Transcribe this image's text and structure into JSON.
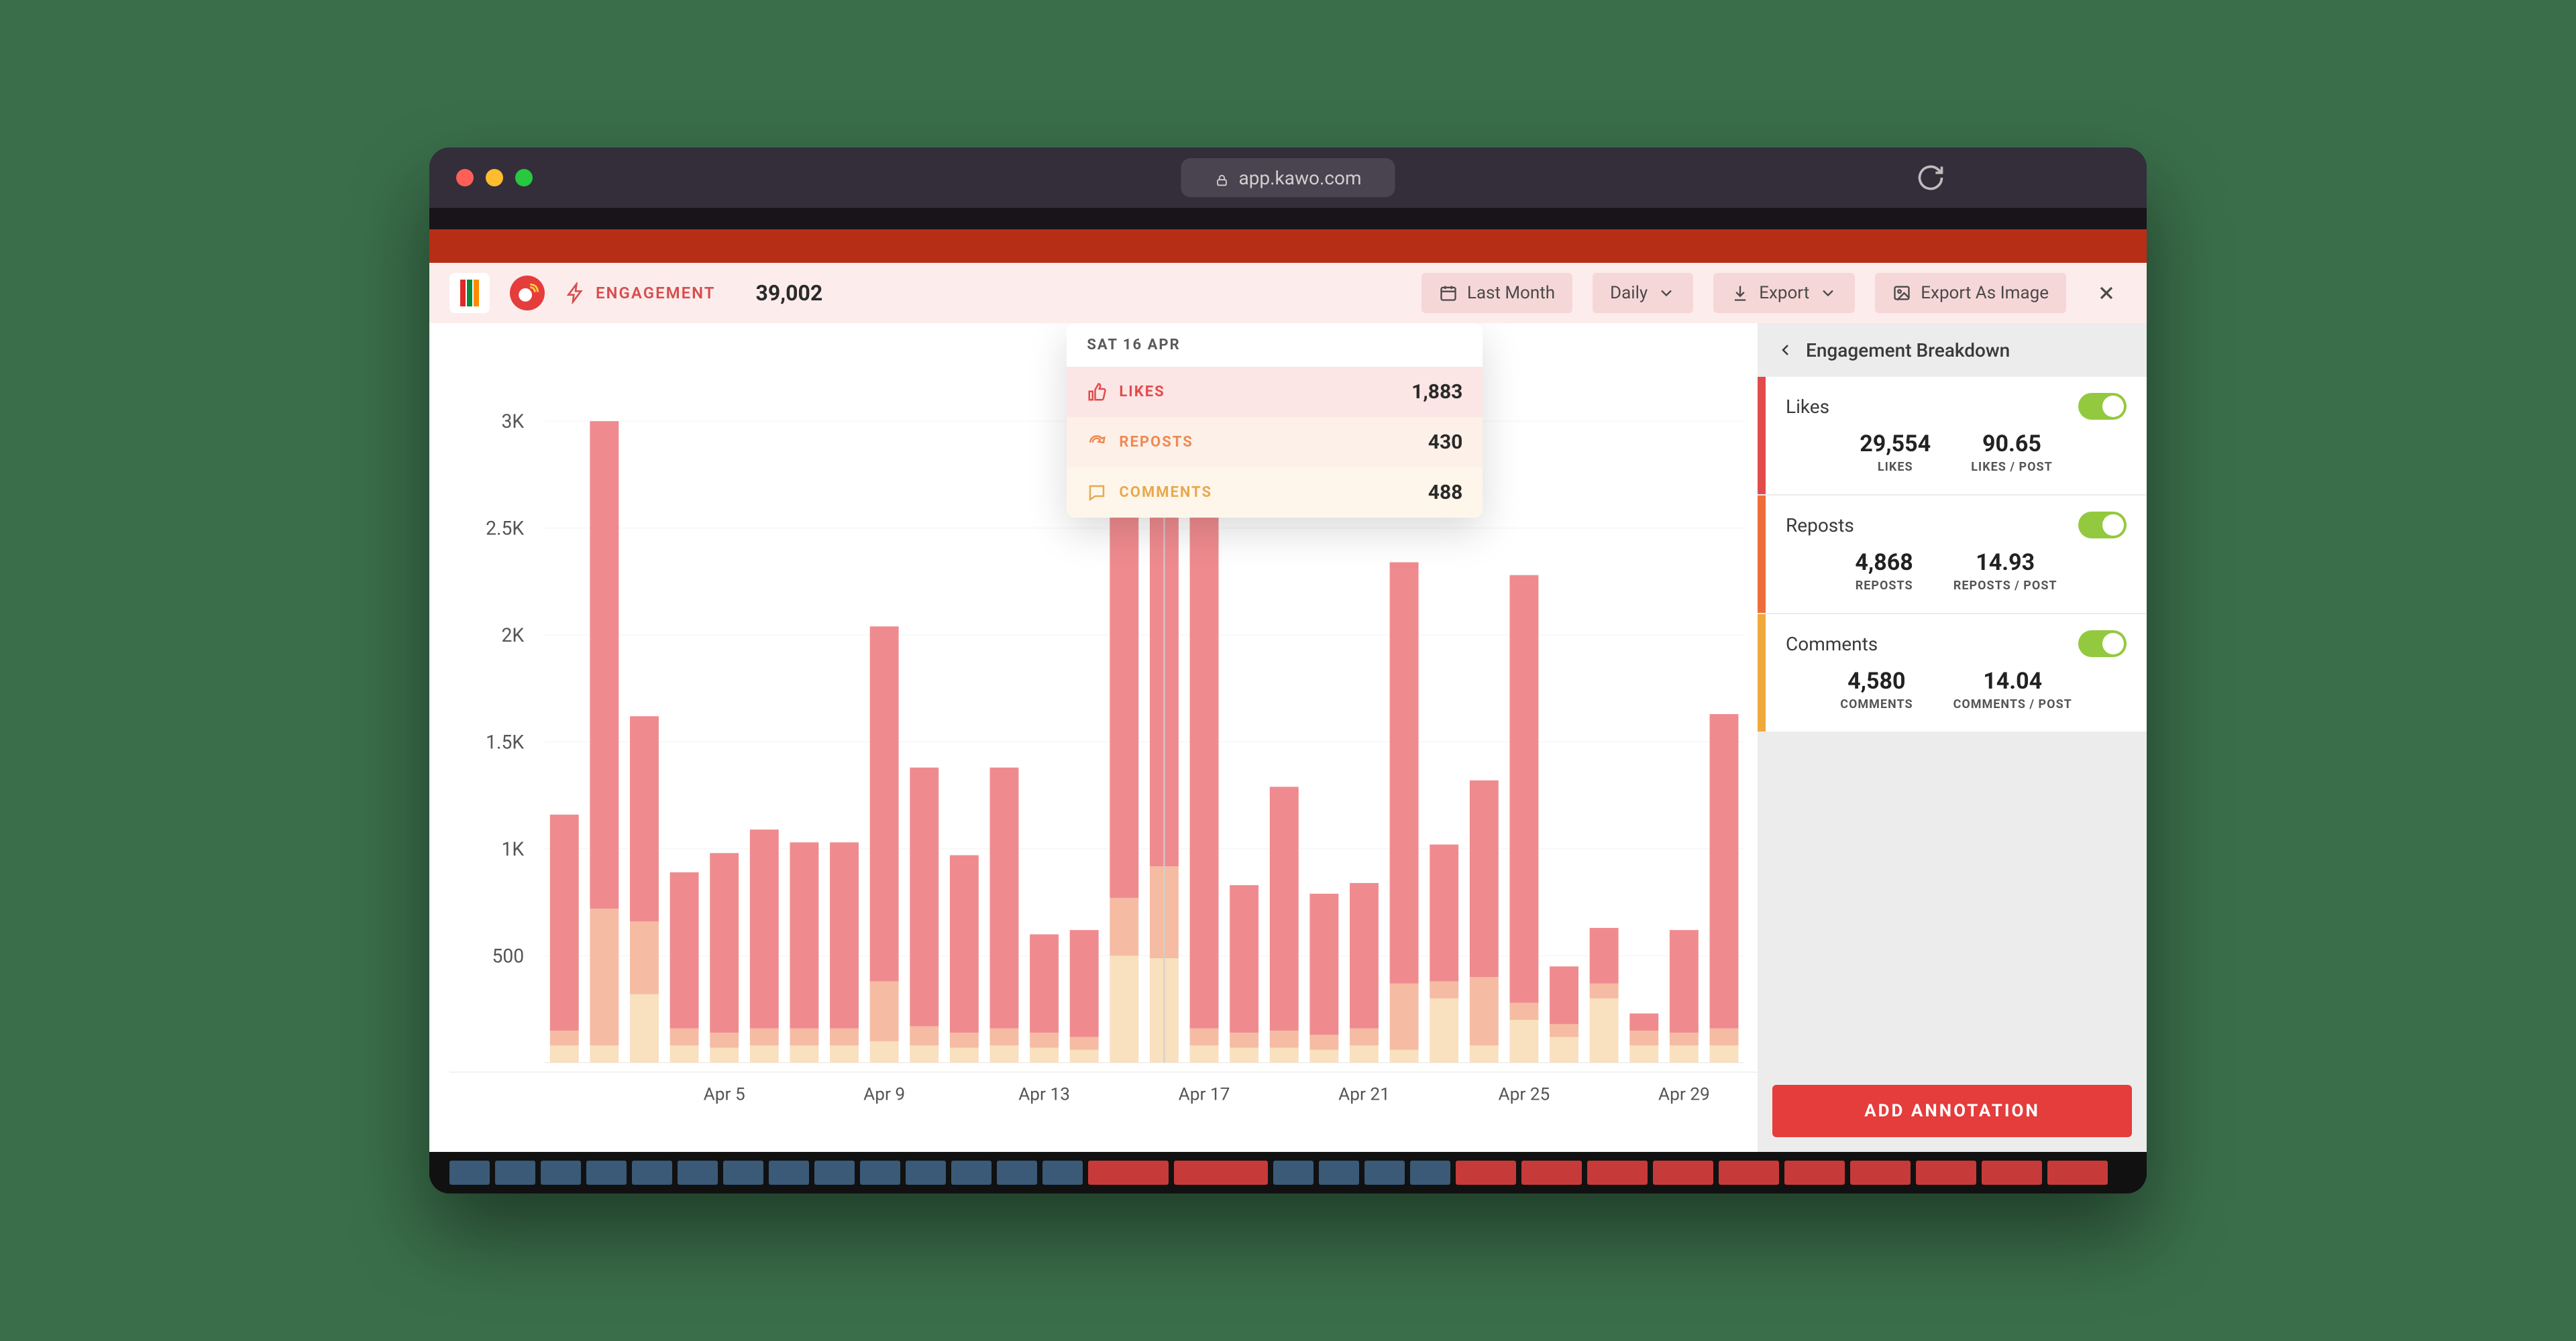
{
  "browser": {
    "url": "app.kawo.com"
  },
  "header": {
    "engagement_label": "ENGAGEMENT",
    "engagement_value": "39,002",
    "date_range": "Last Month",
    "granularity": "Daily",
    "export": "Export",
    "export_image": "Export As Image"
  },
  "tooltip": {
    "date": "SAT 16 APR",
    "likes_label": "LIKES",
    "likes_value": "1,883",
    "reposts_label": "REPOSTS",
    "reposts_value": "430",
    "comments_label": "COMMENTS",
    "comments_value": "488"
  },
  "sidepanel": {
    "title": "Engagement Breakdown",
    "likes": {
      "title": "Likes",
      "total": "29,554",
      "total_label": "LIKES",
      "avg": "90.65",
      "avg_label": "LIKES / POST"
    },
    "reposts": {
      "title": "Reposts",
      "total": "4,868",
      "total_label": "REPOSTS",
      "avg": "14.93",
      "avg_label": "REPOSTS / POST"
    },
    "comments": {
      "title": "Comments",
      "total": "4,580",
      "total_label": "COMMENTS",
      "avg": "14.04",
      "avg_label": "COMMENTS / POST"
    },
    "add_annotation": "ADD ANNOTATION"
  },
  "chart_data": {
    "type": "bar",
    "stacked": true,
    "ylabel": "",
    "ylim": [
      0,
      3200
    ],
    "yticks": [
      "500",
      "1K",
      "1.5K",
      "2K",
      "2.5K",
      "3K"
    ],
    "xticks": [
      "Apr 5",
      "Apr 9",
      "Apr 13",
      "Apr 17",
      "Apr 21",
      "Apr 25",
      "Apr 29"
    ],
    "categories": [
      "Apr 1",
      "Apr 2",
      "Apr 3",
      "Apr 4",
      "Apr 5",
      "Apr 6",
      "Apr 7",
      "Apr 8",
      "Apr 9",
      "Apr 10",
      "Apr 11",
      "Apr 12",
      "Apr 13",
      "Apr 14",
      "Apr 15",
      "Apr 16",
      "Apr 17",
      "Apr 18",
      "Apr 19",
      "Apr 20",
      "Apr 21",
      "Apr 22",
      "Apr 23",
      "Apr 24",
      "Apr 25",
      "Apr 26",
      "Apr 27",
      "Apr 28",
      "Apr 29",
      "Apr 30"
    ],
    "series": [
      {
        "name": "Comments",
        "color": "#f9e0bf",
        "values": [
          80,
          80,
          320,
          80,
          70,
          80,
          80,
          80,
          100,
          80,
          70,
          80,
          70,
          60,
          500,
          488,
          80,
          70,
          70,
          60,
          80,
          60,
          300,
          80,
          200,
          120,
          300,
          80,
          80,
          80
        ]
      },
      {
        "name": "Reposts",
        "color": "#f5bca3",
        "values": [
          70,
          640,
          340,
          80,
          70,
          80,
          80,
          80,
          280,
          90,
          70,
          80,
          70,
          60,
          270,
          430,
          80,
          70,
          80,
          70,
          80,
          310,
          80,
          320,
          80,
          60,
          70,
          70,
          60,
          80
        ]
      },
      {
        "name": "Likes",
        "color": "#ef8b8f",
        "values": [
          1010,
          2280,
          960,
          730,
          840,
          930,
          870,
          870,
          1660,
          1210,
          830,
          1220,
          460,
          500,
          2030,
          1883,
          2480,
          690,
          1140,
          660,
          680,
          1970,
          640,
          920,
          2000,
          270,
          260,
          80,
          480,
          1470
        ]
      }
    ]
  }
}
